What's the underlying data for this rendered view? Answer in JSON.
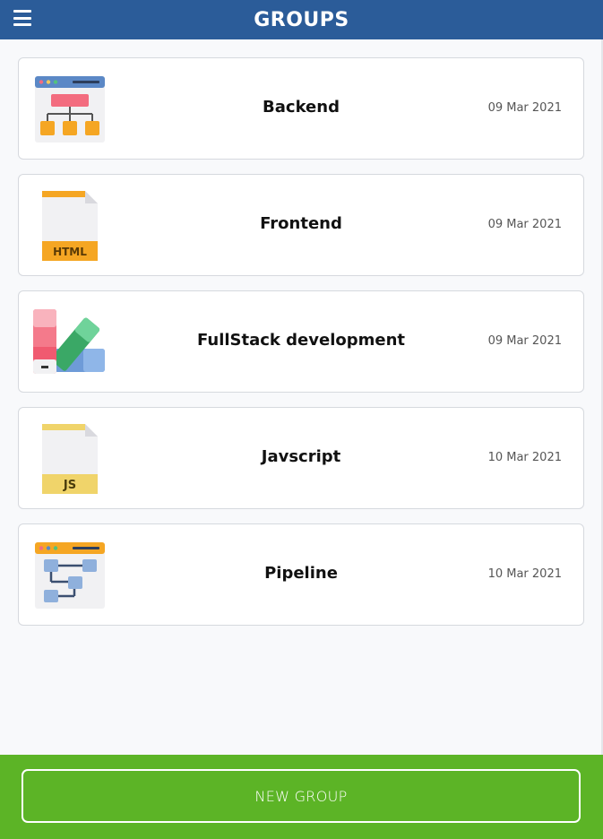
{
  "header": {
    "title": "GROUPS",
    "menu_icon": "hamburger-menu-icon"
  },
  "groups": [
    {
      "name": "Backend",
      "date": "09 Mar 2021",
      "icon": "sitemap-browser-icon"
    },
    {
      "name": "Frontend",
      "date": "09 Mar 2021",
      "icon": "html-file-icon"
    },
    {
      "name": "FullStack development",
      "date": "09 Mar 2021",
      "icon": "color-palette-icon"
    },
    {
      "name": "Javscript",
      "date": "10 Mar 2021",
      "icon": "js-file-icon"
    },
    {
      "name": "Pipeline",
      "date": "10 Mar 2021",
      "icon": "pipeline-flow-icon"
    }
  ],
  "footer": {
    "new_group_label": "NEW GROUP"
  },
  "colors": {
    "header_bg": "#2b5c99",
    "footer_bg": "#5cb426",
    "page_bg": "#f8f9fb"
  }
}
